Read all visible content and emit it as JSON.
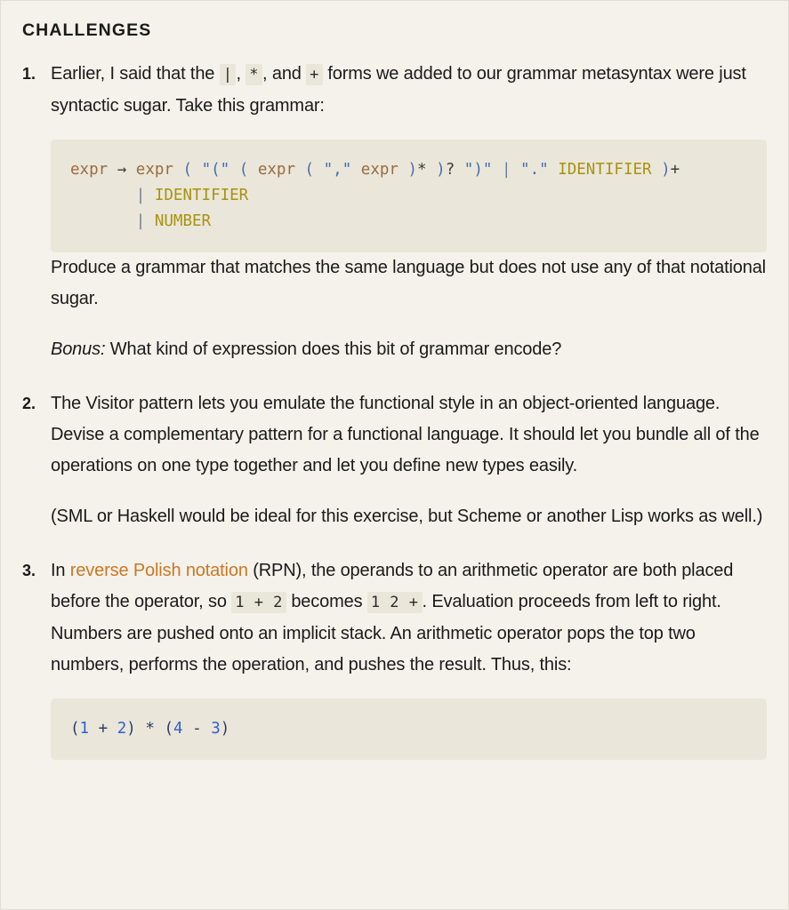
{
  "page": {
    "background_color": "#f5f2ec",
    "code_background_color": "#eae6da",
    "link_color": "#cc7722",
    "text_color": "#1a1a1a"
  },
  "heading": "CHALLENGES",
  "challenges": [
    {
      "number": "1.",
      "intro": {
        "part1": "Earlier, I said that the ",
        "code1": "|",
        "part2": ", ",
        "code2": "*",
        "part3": ", and ",
        "code3": "+",
        "part4": " forms we added to our grammar metasyntax were just syntactic sugar. Take this grammar:"
      },
      "code_block": {
        "lines": [
          {
            "tokens": [
              {
                "t": "expr",
                "c": "rule"
              },
              {
                "t": " ",
                "c": "plain"
              },
              {
                "t": "→",
                "c": "arrow"
              },
              {
                "t": " ",
                "c": "plain"
              },
              {
                "t": "expr",
                "c": "rule"
              },
              {
                "t": " ",
                "c": "plain"
              },
              {
                "t": "(",
                "c": "punct"
              },
              {
                "t": " ",
                "c": "plain"
              },
              {
                "t": "\"(\"",
                "c": "str"
              },
              {
                "t": " ",
                "c": "plain"
              },
              {
                "t": "(",
                "c": "punct"
              },
              {
                "t": " ",
                "c": "plain"
              },
              {
                "t": "expr",
                "c": "rule"
              },
              {
                "t": " ",
                "c": "plain"
              },
              {
                "t": "(",
                "c": "punct"
              },
              {
                "t": " ",
                "c": "plain"
              },
              {
                "t": "\",\"",
                "c": "str"
              },
              {
                "t": " ",
                "c": "plain"
              },
              {
                "t": "expr",
                "c": "rule"
              },
              {
                "t": " ",
                "c": "plain"
              },
              {
                "t": ")",
                "c": "punct"
              },
              {
                "t": "*",
                "c": "op"
              },
              {
                "t": " ",
                "c": "plain"
              },
              {
                "t": ")",
                "c": "punct"
              },
              {
                "t": "?",
                "c": "op"
              },
              {
                "t": " ",
                "c": "plain"
              },
              {
                "t": "\")\"",
                "c": "str"
              },
              {
                "t": " ",
                "c": "plain"
              },
              {
                "t": "|",
                "c": "pipe"
              },
              {
                "t": " ",
                "c": "plain"
              },
              {
                "t": "\".\"",
                "c": "str"
              },
              {
                "t": " ",
                "c": "plain"
              },
              {
                "t": "IDENTIFIER",
                "c": "term"
              },
              {
                "t": " ",
                "c": "plain"
              },
              {
                "t": ")",
                "c": "punct"
              },
              {
                "t": "+",
                "c": "op"
              }
            ]
          },
          {
            "tokens": [
              {
                "t": "       ",
                "c": "plain"
              },
              {
                "t": "|",
                "c": "pipe"
              },
              {
                "t": " ",
                "c": "plain"
              },
              {
                "t": "IDENTIFIER",
                "c": "term"
              }
            ]
          },
          {
            "tokens": [
              {
                "t": "       ",
                "c": "plain"
              },
              {
                "t": "|",
                "c": "pipe"
              },
              {
                "t": " ",
                "c": "plain"
              },
              {
                "t": "NUMBER",
                "c": "term"
              }
            ]
          }
        ]
      },
      "after_code": "Produce a grammar that matches the same language but does not use any of that notational sugar.",
      "bonus_label": "Bonus:",
      "bonus_text": " What kind of expression does this bit of grammar encode?"
    },
    {
      "number": "2.",
      "paragraph1": "The Visitor pattern lets you emulate the functional style in an object-oriented language. Devise a complementary pattern for a functional language. It should let you bundle all of the operations on one type together and let you define new types easily.",
      "paragraph2": "(SML or Haskell would be ideal for this exercise, but Scheme or another Lisp works as well.)"
    },
    {
      "number": "3.",
      "intro": {
        "part1": "In ",
        "link": "reverse Polish notation",
        "part2": " (RPN), the operands to an arithmetic operator are both placed before the operator, so ",
        "code1": "1 + 2",
        "part3": " becomes ",
        "code2": "1 2 +",
        "part4": ". Evaluation proceeds from left to right. Numbers are pushed onto an implicit stack. An arithmetic operator pops the top two numbers, performs the operation, and pushes the result. Thus, this:"
      },
      "code_block": {
        "lines": [
          {
            "tokens": [
              {
                "t": "(",
                "c": "paren"
              },
              {
                "t": "1",
                "c": "num"
              },
              {
                "t": " ",
                "c": "plain"
              },
              {
                "t": "+",
                "c": "aop"
              },
              {
                "t": " ",
                "c": "plain"
              },
              {
                "t": "2",
                "c": "num"
              },
              {
                "t": ")",
                "c": "paren"
              },
              {
                "t": " ",
                "c": "plain"
              },
              {
                "t": "*",
                "c": "aop"
              },
              {
                "t": " ",
                "c": "plain"
              },
              {
                "t": "(",
                "c": "paren"
              },
              {
                "t": "4",
                "c": "num"
              },
              {
                "t": " ",
                "c": "plain"
              },
              {
                "t": "-",
                "c": "aop"
              },
              {
                "t": " ",
                "c": "plain"
              },
              {
                "t": "3",
                "c": "num"
              },
              {
                "t": ")",
                "c": "paren"
              }
            ]
          }
        ]
      }
    }
  ]
}
